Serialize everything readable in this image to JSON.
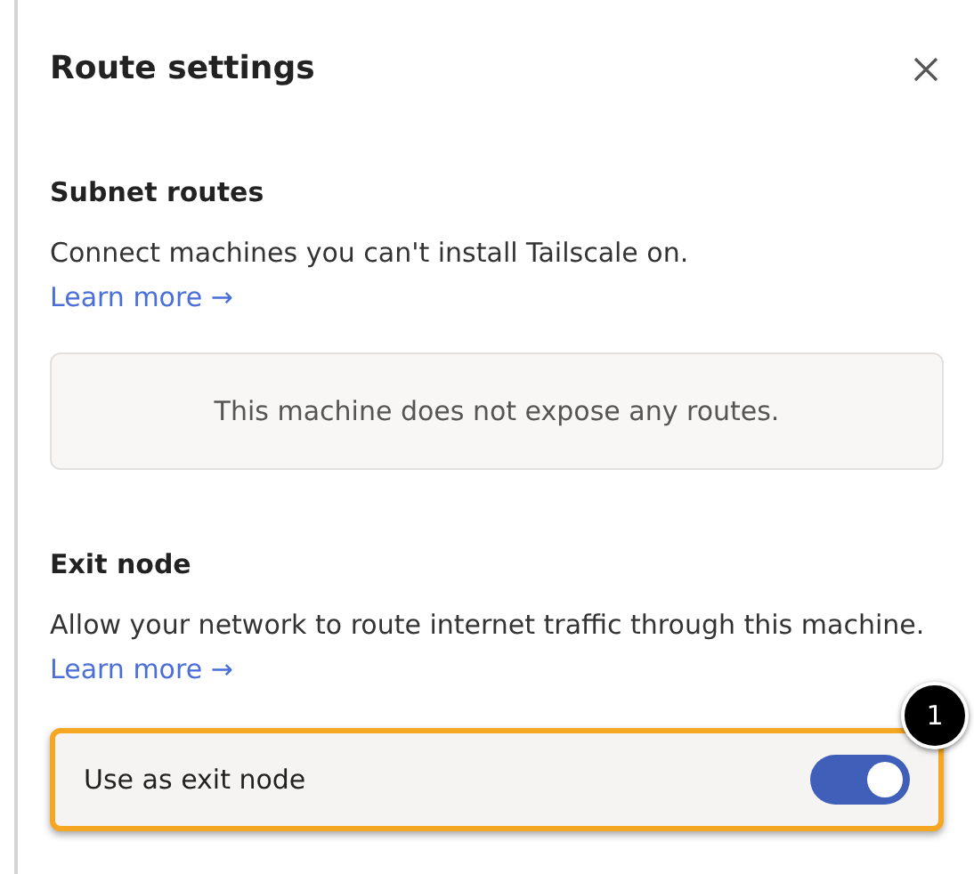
{
  "panel": {
    "title": "Route settings"
  },
  "subnet_routes": {
    "heading": "Subnet routes",
    "description": "Connect machines you can't install Tailscale on.",
    "link": "Learn more →",
    "empty_message": "This machine does not expose any routes."
  },
  "exit_node": {
    "heading": "Exit node",
    "description": "Allow your network to route internet traffic through this machine.",
    "link": "Learn more →",
    "toggle": {
      "label": "Use as exit node",
      "on": true,
      "highlighted": true,
      "callout": "1"
    }
  }
}
